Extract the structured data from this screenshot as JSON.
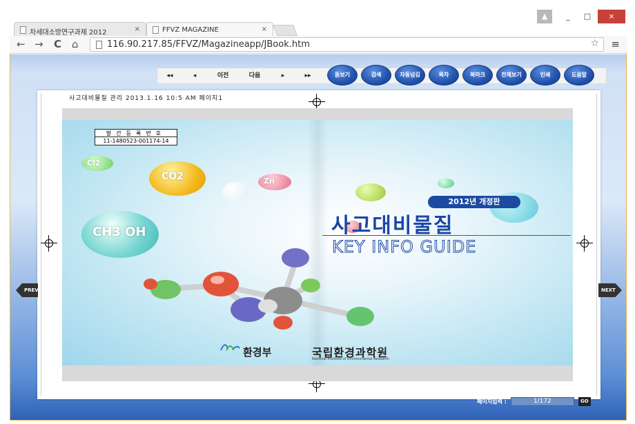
{
  "browser": {
    "tabs": [
      {
        "title": "차세대소방연구과제 2012",
        "state": "inactive"
      },
      {
        "title": "FFVZ MAGAZINE",
        "state": "active"
      }
    ],
    "close_glyph": "×",
    "url": "116.90.217.85/FFVZ/Magazineapp/JBook.htm",
    "nav": {
      "back": "←",
      "forward": "→",
      "reload": "C",
      "home": "⌂"
    },
    "star_glyph": "☆",
    "menu_glyph": "≡",
    "window_buttons": {
      "user": "▲",
      "minimize": "_",
      "maximize": "□",
      "close": "×"
    }
  },
  "viewer": {
    "pager": {
      "first": "◂◂",
      "prev_small": "◂",
      "prev": "이전",
      "next": "다음",
      "next_small": "▸",
      "last": "▸▸"
    },
    "round_buttons": [
      "돋보기",
      "검색",
      "자동넘김",
      "목차",
      "북마크",
      "전체보기",
      "인쇄",
      "도움말"
    ],
    "prev_label": "PREV",
    "next_label": "NEXT",
    "top_info": "사고대비물질 관리 2013.1.16 10:5 AM 페이지1",
    "page_input": {
      "label": "페이지입력 :",
      "value": "1/172",
      "go_label": "GO"
    }
  },
  "cover": {
    "reg_title": "발간등록번호",
    "reg_number": "11-1480523-001174-14",
    "edition": "2012년 개정판",
    "title_ko": "사고대비물질",
    "title_en": "KEY INFO GUIDE",
    "ministry": "환경부",
    "institute_ko": "국립환경과학원",
    "institute_en": "National Institute of Environmental Research",
    "molecules": {
      "cl2": "Cl2",
      "co2": "CO2",
      "zn": "Zn",
      "ch3oh": "CH3 OH"
    }
  },
  "colors": {
    "accent": "#1c46a6",
    "viewer_bottom": "#2e62b8",
    "close": "#c7413b"
  }
}
